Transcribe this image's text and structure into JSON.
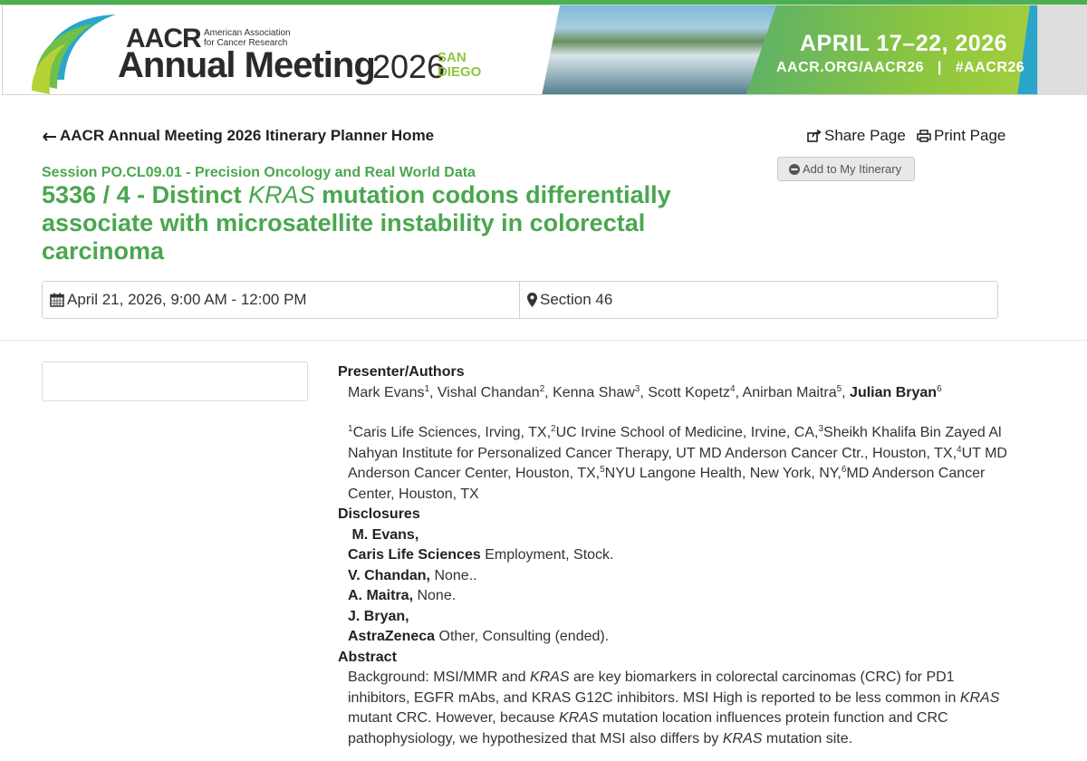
{
  "banner": {
    "org_short": "AACR",
    "org_full_line1": "American Association",
    "org_full_line2": "for Cancer Research",
    "event": "Annual Meeting",
    "year": "2026",
    "city_line1": "SAN",
    "city_line2": "DIEGO",
    "dates": "APRIL 17–22, 2026",
    "url": "AACR.ORG/AACR26",
    "separator": "|",
    "hashtag": "#AACR26",
    "colors": {
      "brand_green": "#4aa74e",
      "accent_lime": "#8dc63f",
      "accent_teal": "#29a6c9"
    }
  },
  "nav": {
    "home_link": "AACR Annual Meeting 2026 Itinerary Planner Home",
    "share": "Share Page",
    "print": "Print Page",
    "add_itinerary": "Add to My Itinerary"
  },
  "session": {
    "label": "Session PO.CL09.01 - Precision Oncology and Real World Data",
    "title_prefix": "5336 / 4 - Distinct ",
    "title_italic": "KRAS",
    "title_suffix": " mutation codons differentially associate with microsatellite instability in colorectal carcinoma",
    "datetime": "April 21, 2026, 9:00 AM - 12:00 PM",
    "location": "Section 46"
  },
  "presenter": {
    "heading": "Presenter/Authors",
    "authors": [
      {
        "name": "Mark Evans",
        "sup": "1",
        "bold": false
      },
      {
        "name": "Vishal Chandan",
        "sup": "2",
        "bold": false
      },
      {
        "name": "Kenna Shaw",
        "sup": "3",
        "bold": false
      },
      {
        "name": "Scott Kopetz",
        "sup": "4",
        "bold": false
      },
      {
        "name": "Anirban Maitra",
        "sup": "5",
        "bold": false
      },
      {
        "name": "Julian Bryan",
        "sup": "6",
        "bold": true
      }
    ],
    "affiliations": [
      {
        "sup": "1",
        "text": "Caris Life Sciences, Irving, TX,"
      },
      {
        "sup": "2",
        "text": "UC Irvine School of Medicine, Irvine, CA,"
      },
      {
        "sup": "3",
        "text": "Sheikh Khalifa Bin Zayed Al Nahyan Institute for Personalized Cancer Therapy, UT MD Anderson Cancer Ctr., Houston, TX,"
      },
      {
        "sup": "4",
        "text": "UT MD Anderson Cancer Center, Houston, TX,"
      },
      {
        "sup": "5",
        "text": "NYU Langone Health, New York, NY,"
      },
      {
        "sup": "6",
        "text": "MD Anderson Cancer Center, Houston, TX"
      }
    ]
  },
  "disclosures": {
    "heading": "Disclosures",
    "items": [
      {
        "name": "M. Evans,",
        "org": "Caris Life Sciences",
        "detail": "Employment, Stock."
      },
      {
        "name": "V. Chandan,",
        "detail": "None.."
      },
      {
        "name": "A. Maitra,",
        "detail": "None."
      },
      {
        "name": "J. Bryan,",
        "org": "AstraZeneca",
        "detail": "Other, Consulting (ended)."
      }
    ]
  },
  "abstract": {
    "heading": "Abstract",
    "text_parts": [
      {
        "t": "Background: MSI/MMR and ",
        "i": false
      },
      {
        "t": "KRAS",
        "i": true
      },
      {
        "t": " are key biomarkers in colorectal carcinomas (CRC) for PD1 inhibitors, EGFR mAbs, and KRAS G12C inhibitors. MSI High is reported to be less common in ",
        "i": false
      },
      {
        "t": "KRAS",
        "i": true
      },
      {
        "t": " mutant CRC. However, because ",
        "i": false
      },
      {
        "t": "KRAS",
        "i": true
      },
      {
        "t": " mutation location influences protein function and CRC pathophysiology, we hypothesized that MSI also differs by ",
        "i": false
      },
      {
        "t": "KRAS",
        "i": true
      },
      {
        "t": " mutation site.",
        "i": false
      }
    ]
  }
}
